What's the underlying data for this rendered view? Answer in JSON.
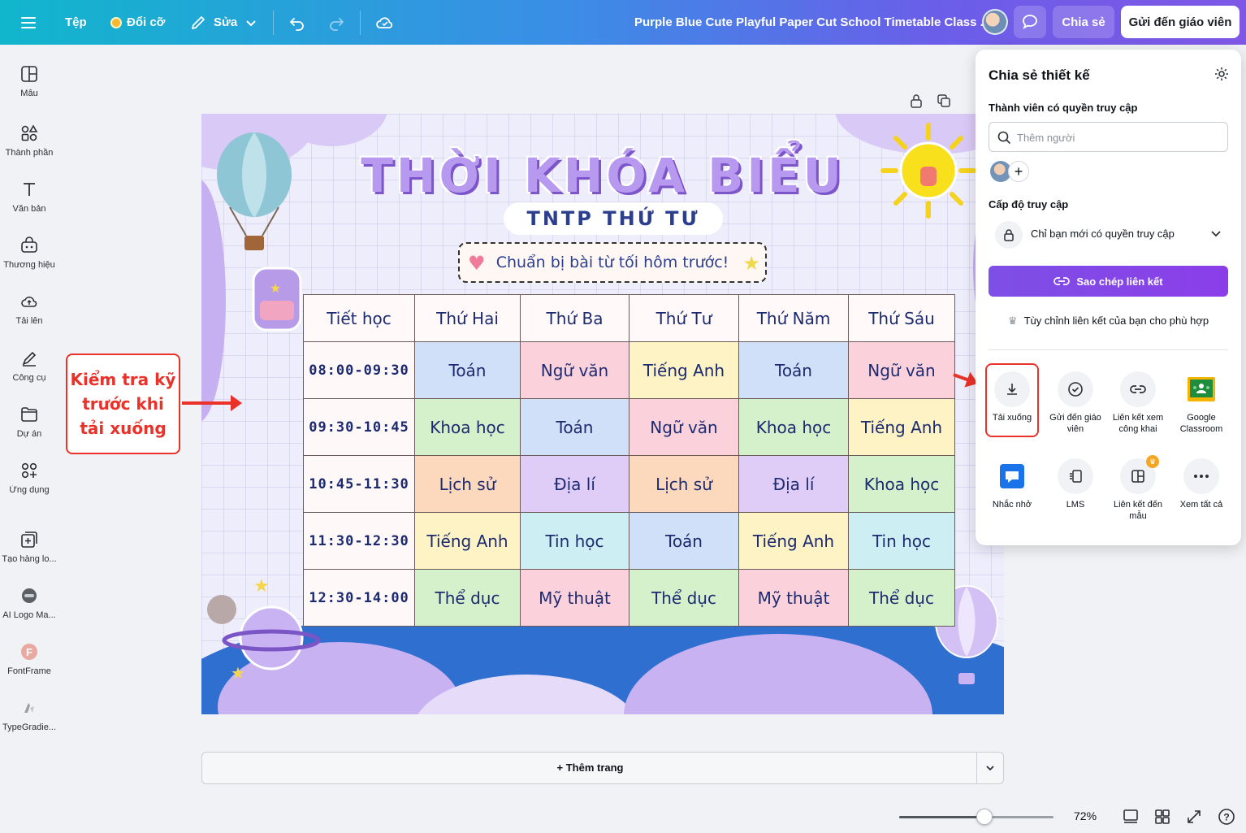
{
  "topbar": {
    "menu_icon": "hamburger-icon",
    "file_label": "Tệp",
    "resize_label": "Đổi cỡ",
    "edit_label": "Sửa",
    "doc_title": "Purple Blue Cute Playful Paper Cut School Timetable Class ...",
    "share_label": "Chia sẻ",
    "send_teacher_label": "Gửi đến giáo viên"
  },
  "sidebar": {
    "items": [
      {
        "label": "Mẫu",
        "icon": "template-icon"
      },
      {
        "label": "Thành phần",
        "icon": "elements-icon"
      },
      {
        "label": "Văn bản",
        "icon": "text-icon"
      },
      {
        "label": "Thương hiệu",
        "icon": "brand-icon"
      },
      {
        "label": "Tải lên",
        "icon": "upload-cloud-icon"
      },
      {
        "label": "Công cụ",
        "icon": "draw-tool-icon"
      },
      {
        "label": "Dự án",
        "icon": "folder-icon"
      },
      {
        "label": "Ứng dụng",
        "icon": "apps-icon"
      },
      {
        "label": "Tạo hàng lo...",
        "icon": "bulk-create-icon"
      },
      {
        "label": "AI Logo Ma...",
        "icon": "ai-logo-icon"
      },
      {
        "label": "FontFrame",
        "icon": "fontframe-icon"
      },
      {
        "label": "TypeGradie...",
        "icon": "typegradient-icon"
      }
    ]
  },
  "design": {
    "title": "THỜI KHÓA BIỂU",
    "subtitle": "TNTP THỨ TƯ",
    "note": "Chuẩn bị bài từ tối hôm trước!",
    "headers": [
      "Tiết học",
      "Thứ Hai",
      "Thứ Ba",
      "Thứ Tư",
      "Thứ Năm",
      "Thứ Sáu"
    ],
    "rows": [
      {
        "time": "08:00-09:30",
        "cells": [
          "Toán",
          "Ngữ văn",
          "Tiếng Anh",
          "Toán",
          "Ngữ văn"
        ]
      },
      {
        "time": "09:30-10:45",
        "cells": [
          "Khoa học",
          "Toán",
          "Ngữ văn",
          "Khoa học",
          "Tiếng Anh"
        ]
      },
      {
        "time": "10:45-11:30",
        "cells": [
          "Lịch sử",
          "Địa lí",
          "Lịch sử",
          "Địa lí",
          "Khoa học"
        ]
      },
      {
        "time": "11:30-12:30",
        "cells": [
          "Tiếng Anh",
          "Tin học",
          "Toán",
          "Tiếng Anh",
          "Tin học"
        ]
      },
      {
        "time": "12:30-14:00",
        "cells": [
          "Thể dục",
          "Mỹ thuật",
          "Thể dục",
          "Mỹ thuật",
          "Thể dục"
        ]
      }
    ]
  },
  "annotation": {
    "callout_text": "Kiểm tra kỹ trước khi tải xuống",
    "highlight_color": "#e8322a"
  },
  "add_page_label": "+ Thêm trang",
  "zoom": {
    "value_label": "72%",
    "level": 0.72
  },
  "share_panel": {
    "title": "Chia sẻ thiết kế",
    "members_label": "Thành viên có quyền truy cập",
    "search_placeholder": "Thêm người",
    "access_label": "Cấp độ truy cập",
    "access_value": "Chỉ bạn mới có quyền truy cập",
    "copy_link_label": "Sao chép liên kết",
    "customize_label": "Tùy chỉnh liên kết của bạn cho phù hợp",
    "options": [
      {
        "label": "Tải xuống",
        "icon": "download-icon"
      },
      {
        "label": "Gửi đến giáo viên",
        "icon": "check-circle-icon"
      },
      {
        "label": "Liên kết xem công khai",
        "icon": "link-icon"
      },
      {
        "label": "Google Classroom",
        "icon": "google-classroom-icon"
      },
      {
        "label": "Nhắc nhở",
        "icon": "reminder-icon"
      },
      {
        "label": "LMS",
        "icon": "lms-icon"
      },
      {
        "label": "Liên kết đến mẫu",
        "icon": "template-link-icon"
      },
      {
        "label": "Xem tất cả",
        "icon": "more-icon"
      }
    ]
  },
  "colors": {
    "accent": "#8b3ee8",
    "topbar_start": "#11b6cc",
    "topbar_end": "#7f57e6"
  }
}
